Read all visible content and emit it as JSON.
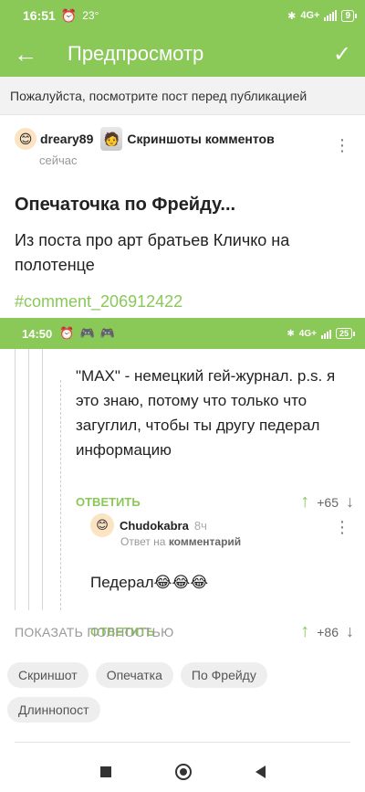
{
  "status_bar": {
    "time": "16:51",
    "temperature": "23°",
    "network": "4G+",
    "battery": "9"
  },
  "app_bar": {
    "title": "Предпросмотр",
    "back_icon": "arrow-left-icon",
    "confirm_icon": "check-icon"
  },
  "notice": "Пожалуйста, посмотрите пост перед публикацией",
  "post": {
    "author": "dreary89",
    "community": "Скриншоты комментов",
    "time": "сейчас",
    "title": "Опечаточка по Фрейду...",
    "text": "Из поста про арт братьев Кличко на полотенце",
    "tag_link": "#comment_206912422"
  },
  "screenshot": {
    "status_bar": {
      "time": "14:50",
      "network": "4G+",
      "battery": "25"
    },
    "comment1": {
      "text": "\"MAX\" - немецкий гей-журнал. p.s. я это знаю, потому что только что загуглил, чтобы ты другу педерал информацию",
      "reply_label": "ОТВЕТИТЬ",
      "votes": "+65"
    },
    "comment2": {
      "author": "Chudokabra",
      "time": "8ч",
      "sub_prefix": "Ответ на",
      "sub_target": "комментарий",
      "text": "Педерал😂😂😂",
      "reply_label": "ОТВЕТИТЬ",
      "votes": "+86"
    }
  },
  "show_full": "ПОКАЗАТЬ ПОЛНОСТЬЮ",
  "tags": [
    "Скриншот",
    "Опечатка",
    "По Фрейду",
    "Длиннопост"
  ],
  "colors": {
    "accent": "#8ac858",
    "notice_bg": "#f2f2f2",
    "tag_bg": "#eeeeee"
  }
}
